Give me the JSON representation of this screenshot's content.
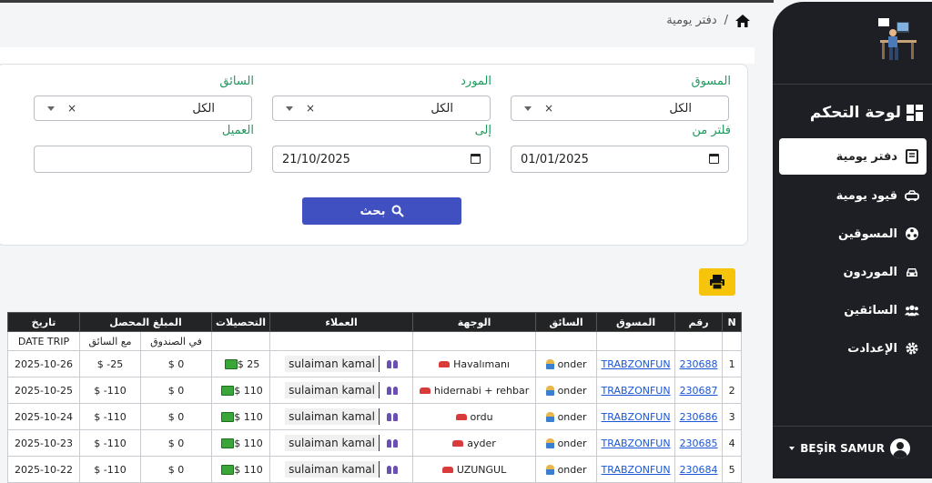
{
  "breadcrumb": {
    "current": "دفتر يومية",
    "separator": "/"
  },
  "sidebar": {
    "brand": "لوحة التحكم",
    "items": [
      {
        "label": "دفتر يومية",
        "icon": "notebook-icon",
        "active": true
      },
      {
        "label": "قيود يومية",
        "icon": "taxi-icon",
        "active": false
      },
      {
        "label": "المسوقين",
        "icon": "reel-icon",
        "active": false
      },
      {
        "label": "الموردون",
        "icon": "car-icon",
        "active": false
      },
      {
        "label": "السائقين",
        "icon": "users-icon",
        "active": false
      },
      {
        "label": "الإعدادت",
        "icon": "gear-icon",
        "active": false
      }
    ],
    "user": "BEŞİR SAMUR"
  },
  "filters": {
    "marketer": {
      "label": "المسوق",
      "value": "الكل",
      "clear": "×"
    },
    "supplier": {
      "label": "المورد",
      "value": "الكل",
      "clear": "×"
    },
    "driver": {
      "label": "السائق",
      "value": "الكل",
      "clear": "×"
    },
    "date_from": {
      "label": "فلتر من",
      "value": "01/01/2025"
    },
    "date_to": {
      "label": "إلى",
      "value": "21/10/2025"
    },
    "customer": {
      "label": "العميل",
      "value": ""
    },
    "search_label": "بحث"
  },
  "table": {
    "headers": {
      "n": "N",
      "number": "رقم",
      "marketer": "المسوق",
      "driver": "السائق",
      "destination": "الوجهة",
      "customers": "العملاء",
      "collections": "التحصيلات",
      "collected": "المبلغ المحصل",
      "date": "تاريخ"
    },
    "subheaders": {
      "in_box": "في الصندوق",
      "with_driver": "مع السائق",
      "date_trip": "DATE TRIP"
    },
    "rows": [
      {
        "n": "1",
        "number": "230688",
        "marketer": "TRABZONFUN",
        "driver": "onder",
        "destination": "Havalımanı",
        "customer": "sulaiman kamal",
        "collection": "$ 25",
        "in_box": "$ 0",
        "with_driver": "$ -25",
        "date": "2025-10-26"
      },
      {
        "n": "2",
        "number": "230687",
        "marketer": "TRABZONFUN",
        "driver": "onder",
        "destination": "hidernabi + rehbar",
        "customer": "sulaiman kamal",
        "collection": "$ 110",
        "in_box": "$ 0",
        "with_driver": "$ -110",
        "date": "2025-10-25"
      },
      {
        "n": "3",
        "number": "230686",
        "marketer": "TRABZONFUN",
        "driver": "onder",
        "destination": "ordu",
        "customer": "sulaiman kamal",
        "collection": "$ 110",
        "in_box": "$ 0",
        "with_driver": "$ -110",
        "date": "2025-10-24"
      },
      {
        "n": "4",
        "number": "230685",
        "marketer": "TRABZONFUN",
        "driver": "onder",
        "destination": "ayder",
        "customer": "sulaiman kamal",
        "collection": "$ 110",
        "in_box": "$ 0",
        "with_driver": "$ -110",
        "date": "2025-10-23"
      },
      {
        "n": "5",
        "number": "230684",
        "marketer": "TRABZONFUN",
        "driver": "onder",
        "destination": "UZUNGUL",
        "customer": "sulaiman kamal",
        "collection": "$ 110",
        "in_box": "$ 0",
        "with_driver": "$ -110",
        "date": "2025-10-22"
      }
    ]
  }
}
